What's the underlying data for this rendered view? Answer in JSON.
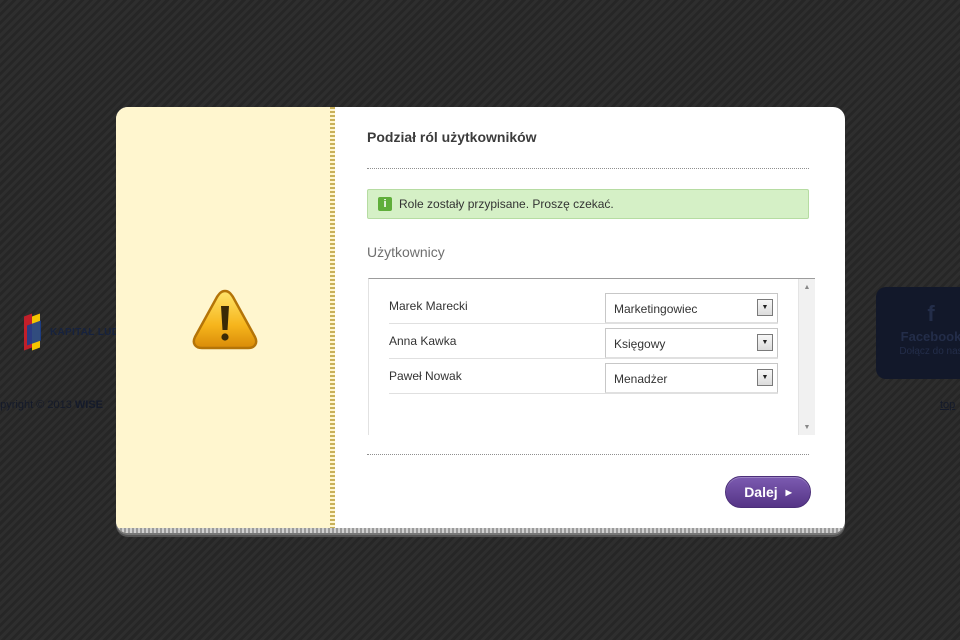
{
  "background": {
    "logo_text": "KAPITAŁ LUD",
    "copyright_prefix": "opyright © 2013",
    "copyright_brand": "WISE",
    "facebook": {
      "icon": "f",
      "title": "Facebook",
      "subtitle": "Dołącz do nas"
    },
    "top_link": "top"
  },
  "modal": {
    "title": "Podział ról użytkowników",
    "notice": {
      "icon": "info-icon",
      "text": "Role zostały przypisane. Proszę czekać.",
      "color": "#d5f0c6"
    },
    "users_label": "Użytkownicy",
    "users": [
      {
        "name": "Marek Marecki",
        "role": "Marketingowiec"
      },
      {
        "name": "Anna Kawka",
        "role": "Księgowy"
      },
      {
        "name": "Paweł Nowak",
        "role": "Menadżer"
      }
    ],
    "next_button": {
      "label": "Dalej",
      "color": "#6a47a0"
    },
    "warning_icon": "warning-triangle-icon"
  }
}
